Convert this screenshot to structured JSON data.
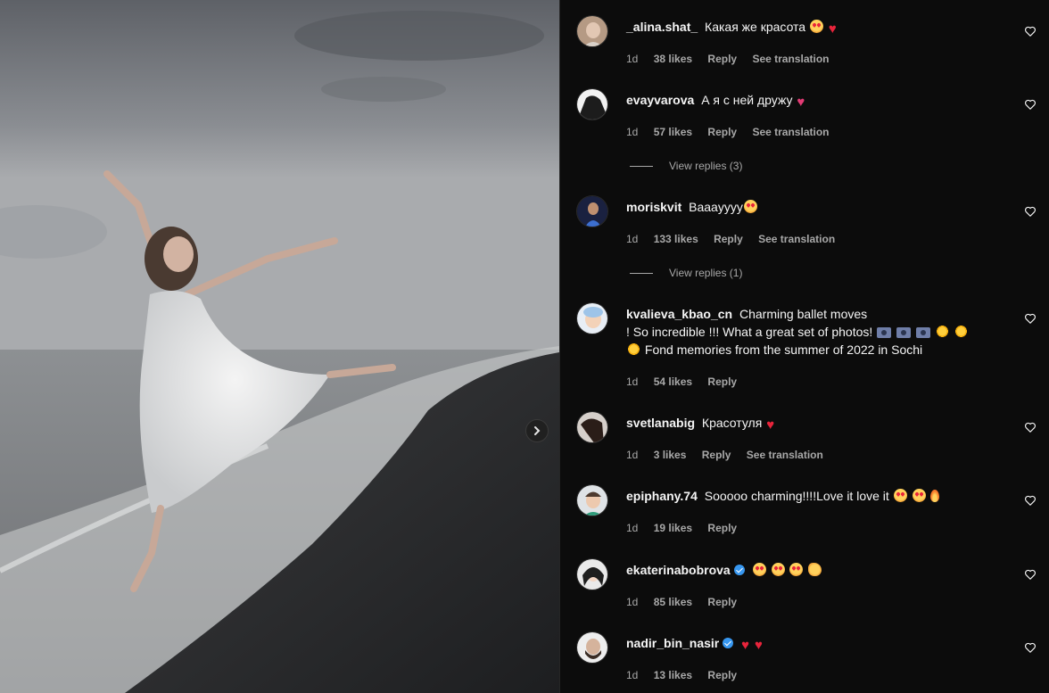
{
  "photo": {
    "next_button_icon": "chevron-right-icon"
  },
  "comments": [
    {
      "username": "_alina.shat_",
      "verified": false,
      "text": "Какая же красота",
      "emojis": [
        "heart-eyes",
        "red-heart"
      ],
      "time": "1d",
      "likes": "38 likes",
      "reply": "Reply",
      "translate": "See translation",
      "view_replies": ""
    },
    {
      "username": "evayvarova",
      "verified": false,
      "text": "А я с ней дружу",
      "emojis": [
        "pink-heart"
      ],
      "time": "1d",
      "likes": "57 likes",
      "reply": "Reply",
      "translate": "See translation",
      "view_replies": "View replies (3)"
    },
    {
      "username": "moriskvit",
      "verified": false,
      "text": "Baaayyyy",
      "emojis": [
        "heart-eyes"
      ],
      "time": "1d",
      "likes": "133 likes",
      "reply": "Reply",
      "translate": "See translation",
      "view_replies": "View replies (1)"
    },
    {
      "username": "kvalieva_kbao_cn",
      "verified": false,
      "text_line1": "Charming ballet moves",
      "text_line2": "! So incredible !!! What a great set of photos!",
      "text_line3": "Fond memories from the summer of 2022 in Sochi",
      "time": "1d",
      "likes": "54 likes",
      "reply": "Reply"
    },
    {
      "username": "svetlanabig",
      "verified": false,
      "text": "Красотуля",
      "emojis": [
        "red-heart"
      ],
      "time": "1d",
      "likes": "3 likes",
      "reply": "Reply",
      "translate": "See translation"
    },
    {
      "username": "epiphany.74",
      "verified": false,
      "text": "Sooooo charming!!!!Love it love it",
      "emojis": [
        "heart-eyes",
        "heart-eyes",
        "fire"
      ],
      "time": "1d",
      "likes": "19 likes",
      "reply": "Reply"
    },
    {
      "username": "ekaterinabobrova",
      "verified": true,
      "text": "",
      "emojis": [
        "heart-eyes",
        "heart-eyes",
        "heart-eyes",
        "clap"
      ],
      "time": "1d",
      "likes": "85 likes",
      "reply": "Reply"
    },
    {
      "username": "nadir_bin_nasir",
      "verified": true,
      "text": "",
      "emojis": [
        "red-heart",
        "red-heart"
      ],
      "time": "1d",
      "likes": "13 likes",
      "reply": "Reply"
    }
  ],
  "colors": {
    "background": "#0c0c0c",
    "text_primary": "#f5f5f5",
    "text_secondary": "#a8a8a8",
    "verified": "#3797f0",
    "heart_red": "#e8243b"
  }
}
